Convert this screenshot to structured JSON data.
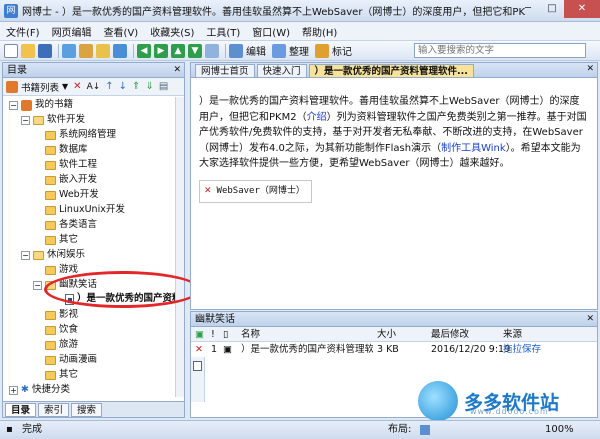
{
  "window": {
    "title": "网博士 - ）是一款优秀的国产资料管理软件。善用佳软虽然算不上WebSaver（网博士）的深度用户，但把它和PK"
  },
  "menu": [
    "文件(F)",
    "网页编辑",
    "查看(V)",
    "收藏夹(S)",
    "工具(T)",
    "窗口(W)",
    "帮助(H)"
  ],
  "toolbar": {
    "edit_label": "编辑",
    "organize_label": "整理",
    "bookmark_label": "标记",
    "search_placeholder": "输入要搜索的文字"
  },
  "left_pane": {
    "title": "目录",
    "toolbar_label": "书籍列表",
    "tree": {
      "root": "我的书籍",
      "software_dev": "软件开发",
      "items_dev": [
        "系统网络管理",
        "数据库",
        "软件工程",
        "嵌入开发",
        "Web开发",
        "LinuxUnix开发",
        "各类语言",
        "其它"
      ],
      "leisure": "休闲娱乐",
      "items_leisure_a": [
        "游戏"
      ],
      "humor": "幽默笑话",
      "selected_doc": "）是一款优秀的国产资料",
      "items_leisure_b": [
        "影视",
        "饮食",
        "旅游",
        "动画漫画",
        "其它"
      ],
      "quick": "快捷分类"
    },
    "tabs": [
      "目录",
      "索引",
      "搜索"
    ]
  },
  "doc_tabs": [
    "网博士首页",
    "快速入门",
    "）是一款优秀的国产资料管理软件..."
  ],
  "content": {
    "p1": "）是一款优秀的国产资料管理软件。善用佳软虽然算不上WebSaver（网博士）的深度用户，但把它和PKM2（",
    "link1": "介绍",
    "p2": "）列为资料管理软件之国产免费类别之第一推荐。基于对国产优秀软件/免费软件的支持，基于对开发者无私奉献、不断改进的支持，在WebSaver（网博士）发布4.0之际，为其新功能制作Flash演示（",
    "link2": "制作工具Wink",
    "p3": "）。希望本文能为大家选择软件提供一些方便，更希望WebSaver（网博士）越来越好。",
    "image_alt": "WebSaver（网博士）"
  },
  "bottom_pane": {
    "title": "幽默笑话",
    "columns": [
      "名称",
      "大小",
      "最后修改",
      "来源"
    ],
    "rows": [
      {
        "name": "）是一款优秀的国产资料管理软...",
        "size": "3 KB",
        "modified": "2016/12/20 9:19",
        "source": "拖拉保存"
      }
    ]
  },
  "status": {
    "left": "完成",
    "layout_label": "布局:",
    "zoom": "100%"
  },
  "watermark": {
    "text": "多多软件站",
    "sub": "www.ddooo.com"
  }
}
